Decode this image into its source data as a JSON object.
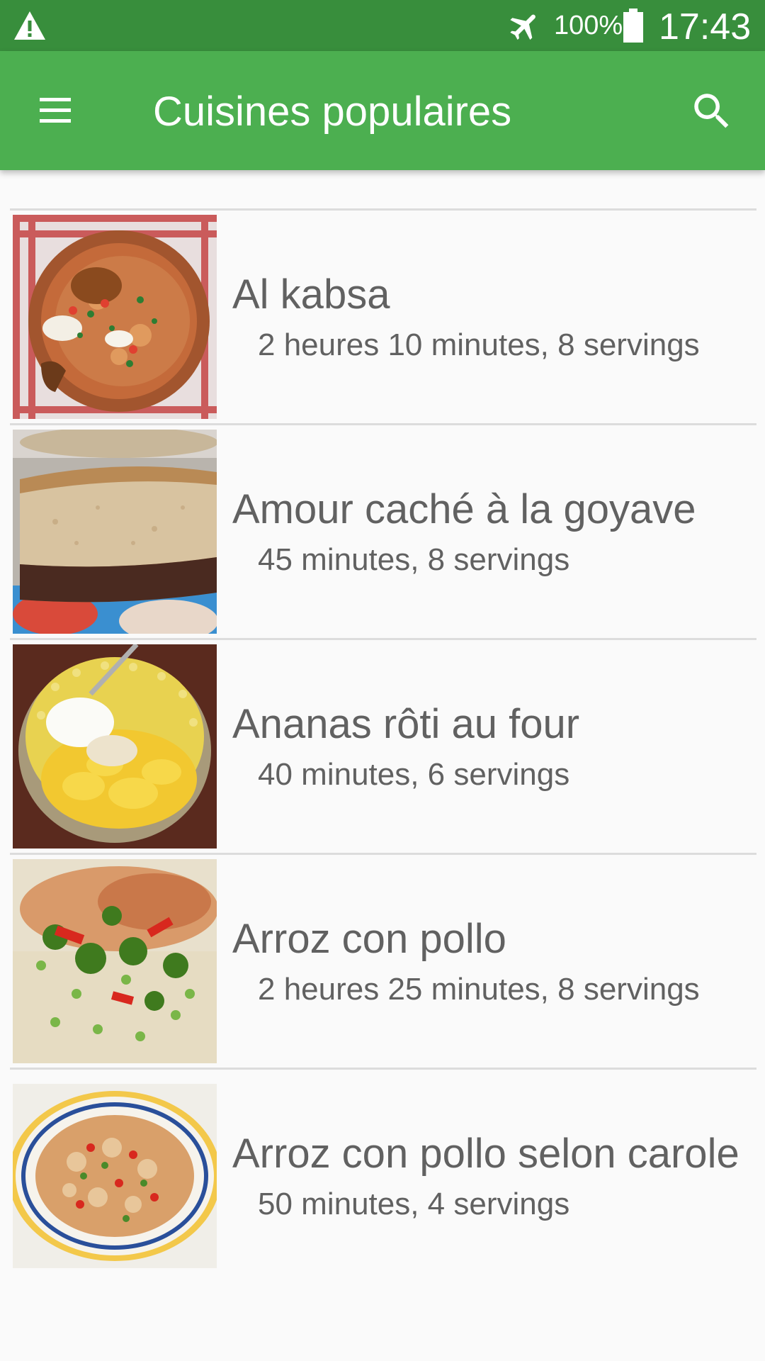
{
  "status_bar": {
    "battery_percent": "100%",
    "time": "17:43",
    "icons": [
      "warning-icon",
      "airplane-mode-icon",
      "battery-icon"
    ]
  },
  "app_bar": {
    "title": "Cuisines populaires",
    "icons": [
      "menu-icon",
      "search-icon"
    ],
    "color": "#4caf50"
  },
  "recipes": [
    {
      "name": "Al kabsa",
      "meta": "2 heures 10 minutes, 8 servings"
    },
    {
      "name": "Amour caché à la goyave",
      "meta": "45 minutes, 8 servings"
    },
    {
      "name": "Ananas rôti au four",
      "meta": "40 minutes, 6 servings"
    },
    {
      "name": "Arroz con pollo",
      "meta": "2 heures 25 minutes, 8 servings"
    },
    {
      "name": "Arroz con pollo selon carole",
      "meta": "50 minutes, 4 servings"
    }
  ]
}
